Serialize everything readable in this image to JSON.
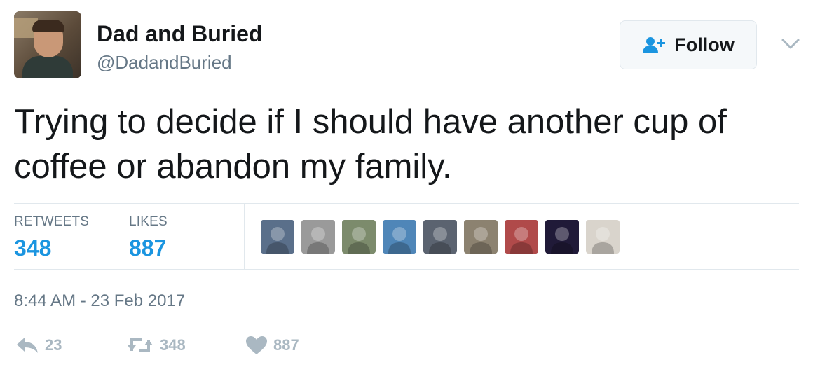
{
  "header": {
    "name": "Dad and Buried",
    "handle": "@DadandBuried",
    "follow_label": "Follow",
    "icons": [
      "follow-person-icon",
      "chevron-down-icon"
    ]
  },
  "tweet": {
    "text": "Trying to decide if I should have another cup of coffee or abandon my family."
  },
  "stats": {
    "retweets_label": "RETWEETS",
    "retweets_count": "348",
    "likes_label": "LIKES",
    "likes_count": "887"
  },
  "likers": [
    {
      "id": "liker-1",
      "color": "#5a6f8a"
    },
    {
      "id": "liker-2",
      "color": "#9a9a9a"
    },
    {
      "id": "liker-3",
      "color": "#7c8b6c"
    },
    {
      "id": "liker-4",
      "color": "#4f86b8"
    },
    {
      "id": "liker-5",
      "color": "#5b6370"
    },
    {
      "id": "liker-6",
      "color": "#8c8270"
    },
    {
      "id": "liker-7",
      "color": "#b04a4a"
    },
    {
      "id": "liker-8",
      "color": "#201a38"
    },
    {
      "id": "liker-9",
      "color": "#d9d4cc"
    }
  ],
  "timestamp": "8:44 AM - 23 Feb 2017",
  "actions": {
    "reply_count": "23",
    "retweet_count": "348",
    "like_count": "887"
  },
  "colors": {
    "accent": "#1b95e0",
    "muted": "#657786",
    "icon_gray": "#aab8c2",
    "border": "#e1e8ed"
  }
}
